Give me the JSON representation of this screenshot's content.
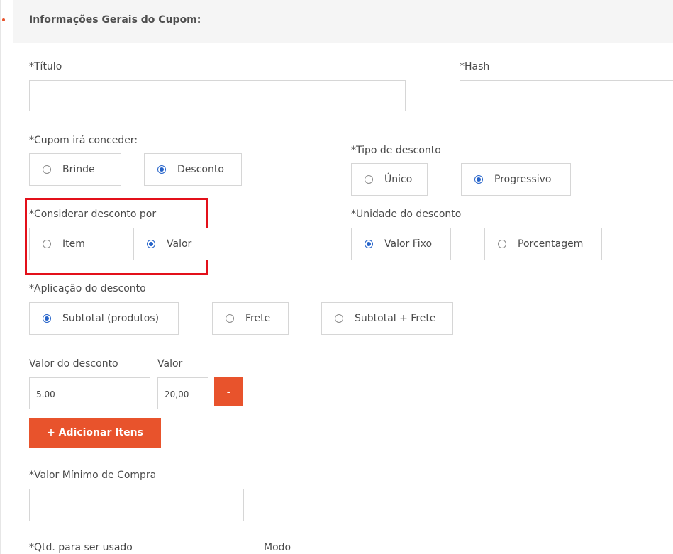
{
  "panel": {
    "title": "Informações Gerais do Cupom:"
  },
  "titulo": {
    "label": "*Título",
    "value": ""
  },
  "hash": {
    "label": "*Hash",
    "value": ""
  },
  "concede": {
    "label": "*Cupom irá conceder:",
    "options": [
      {
        "label": "Brinde",
        "checked": false
      },
      {
        "label": "Desconto",
        "checked": true
      }
    ]
  },
  "tipo_desconto": {
    "label": "*Tipo de desconto",
    "options": [
      {
        "label": "Único",
        "checked": false
      },
      {
        "label": "Progressivo",
        "checked": true
      }
    ]
  },
  "considerar": {
    "label": "*Considerar desconto por",
    "options": [
      {
        "label": "Item",
        "checked": false
      },
      {
        "label": "Valor",
        "checked": true
      }
    ]
  },
  "unidade": {
    "label": "*Unidade do desconto",
    "options": [
      {
        "label": "Valor Fixo",
        "checked": true
      },
      {
        "label": "Porcentagem",
        "checked": false
      }
    ]
  },
  "aplicacao": {
    "label": "*Aplicação do desconto",
    "options": [
      {
        "label": "Subtotal (produtos)",
        "checked": true
      },
      {
        "label": "Frete",
        "checked": false
      },
      {
        "label": "Subtotal + Frete",
        "checked": false
      }
    ]
  },
  "valor_desconto": {
    "label": "Valor do desconto",
    "value": "5.00"
  },
  "valor": {
    "label": "Valor",
    "value": "20,00"
  },
  "remove_button": {
    "label": "-"
  },
  "add_items_button": {
    "label": "+ Adicionar Itens"
  },
  "valor_minimo": {
    "label": "*Valor Mínimo de Compra",
    "value": ""
  },
  "qtd": {
    "label": "*Qtd. para ser usado"
  },
  "modo": {
    "label": "Modo"
  },
  "colors": {
    "accent": "#e8532c",
    "highlight": "#e3101a",
    "radio": "#2563c9"
  }
}
